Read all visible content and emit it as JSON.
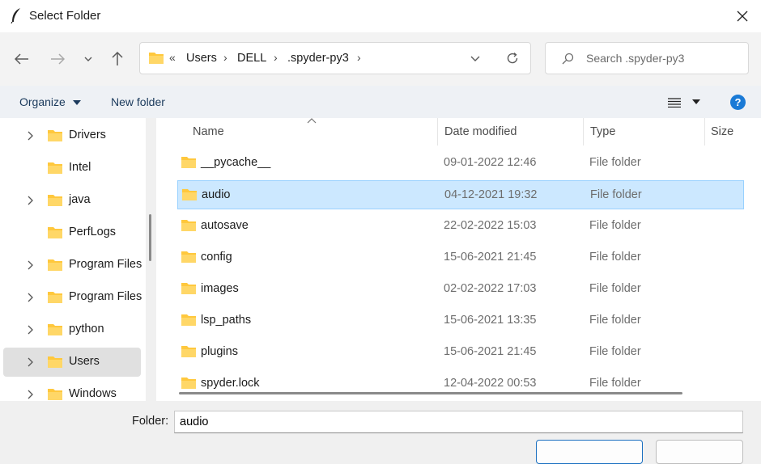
{
  "window": {
    "title": "Select Folder"
  },
  "address": {
    "overflow": "«",
    "crumbs": [
      "Users",
      "DELL",
      ".spyder-py3"
    ]
  },
  "search": {
    "placeholder": "Search .spyder-py3"
  },
  "toolbar": {
    "organize_label": "Organize",
    "new_folder_label": "New folder",
    "help_label": "?"
  },
  "sidebar": {
    "items": [
      {
        "label": "Drivers",
        "expandable": true,
        "selected": false
      },
      {
        "label": "Intel",
        "expandable": false,
        "selected": false
      },
      {
        "label": "java",
        "expandable": true,
        "selected": false
      },
      {
        "label": "PerfLogs",
        "expandable": false,
        "selected": false
      },
      {
        "label": "Program Files",
        "expandable": true,
        "selected": false
      },
      {
        "label": "Program Files",
        "expandable": true,
        "selected": false
      },
      {
        "label": "python",
        "expandable": true,
        "selected": false
      },
      {
        "label": "Users",
        "expandable": true,
        "selected": true
      },
      {
        "label": "Windows",
        "expandable": true,
        "selected": false
      }
    ]
  },
  "columns": {
    "name": "Name",
    "date": "Date modified",
    "type": "Type",
    "size": "Size"
  },
  "files": [
    {
      "name": "__pycache__",
      "date": "09-01-2022 12:46",
      "type": "File folder",
      "selected": false
    },
    {
      "name": "audio",
      "date": "04-12-2021 19:32",
      "type": "File folder",
      "selected": true
    },
    {
      "name": "autosave",
      "date": "22-02-2022 15:03",
      "type": "File folder",
      "selected": false
    },
    {
      "name": "config",
      "date": "15-06-2021 21:45",
      "type": "File folder",
      "selected": false
    },
    {
      "name": "images",
      "date": "02-02-2022 17:03",
      "type": "File folder",
      "selected": false
    },
    {
      "name": "lsp_paths",
      "date": "15-06-2021 13:35",
      "type": "File folder",
      "selected": false
    },
    {
      "name": "plugins",
      "date": "15-06-2021 21:45",
      "type": "File folder",
      "selected": false
    },
    {
      "name": "spyder.lock",
      "date": "12-04-2022 00:53",
      "type": "File folder",
      "selected": false
    }
  ],
  "footer": {
    "folder_label": "Folder:",
    "folder_value": "audio"
  },
  "colors": {
    "accent": "#1a7ad6",
    "selection": "#cce8ff",
    "folder": "#ffc83d"
  }
}
